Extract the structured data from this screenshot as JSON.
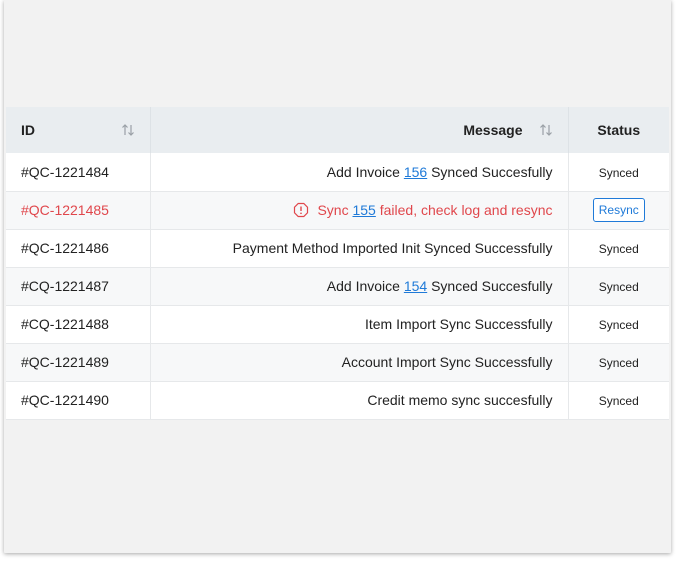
{
  "table": {
    "headers": {
      "id": "ID",
      "message": "Message",
      "status": "Status"
    },
    "rows": [
      {
        "id": "#QC-1221484",
        "msg_pre": "Add Invoice ",
        "link": "156",
        "msg_post": " Synced Succesfully",
        "status": "Synced"
      },
      {
        "id": "#QC-1221485",
        "msg_pre": "Sync ",
        "link": "155",
        "msg_post": " failed, check log and resync",
        "status": "Resync",
        "error": true
      },
      {
        "id": "#QC-1221486",
        "msg_pre": "Payment Method Imported Init Synced Successfully",
        "status": "Synced"
      },
      {
        "id": "#CQ-1221487",
        "msg_pre": "Add Invoice ",
        "link": "154",
        "msg_post": " Synced Succesfully",
        "status": "Synced"
      },
      {
        "id": "#CQ-1221488",
        "msg_pre": "Item Import Sync Successfully",
        "status": "Synced"
      },
      {
        "id": "#QC-1221489",
        "msg_pre": "Account Import Sync Successfully",
        "status": "Synced"
      },
      {
        "id": "#QC-1221490",
        "msg_pre": "Credit memo sync succesfully",
        "status": "Synced"
      }
    ]
  },
  "icons": {
    "sort": "sort-arrows-icon",
    "warning": "warning-octagon-icon"
  },
  "colors": {
    "error": "#e0474c",
    "link": "#1f7ad8",
    "header_bg": "#e9edf0"
  }
}
